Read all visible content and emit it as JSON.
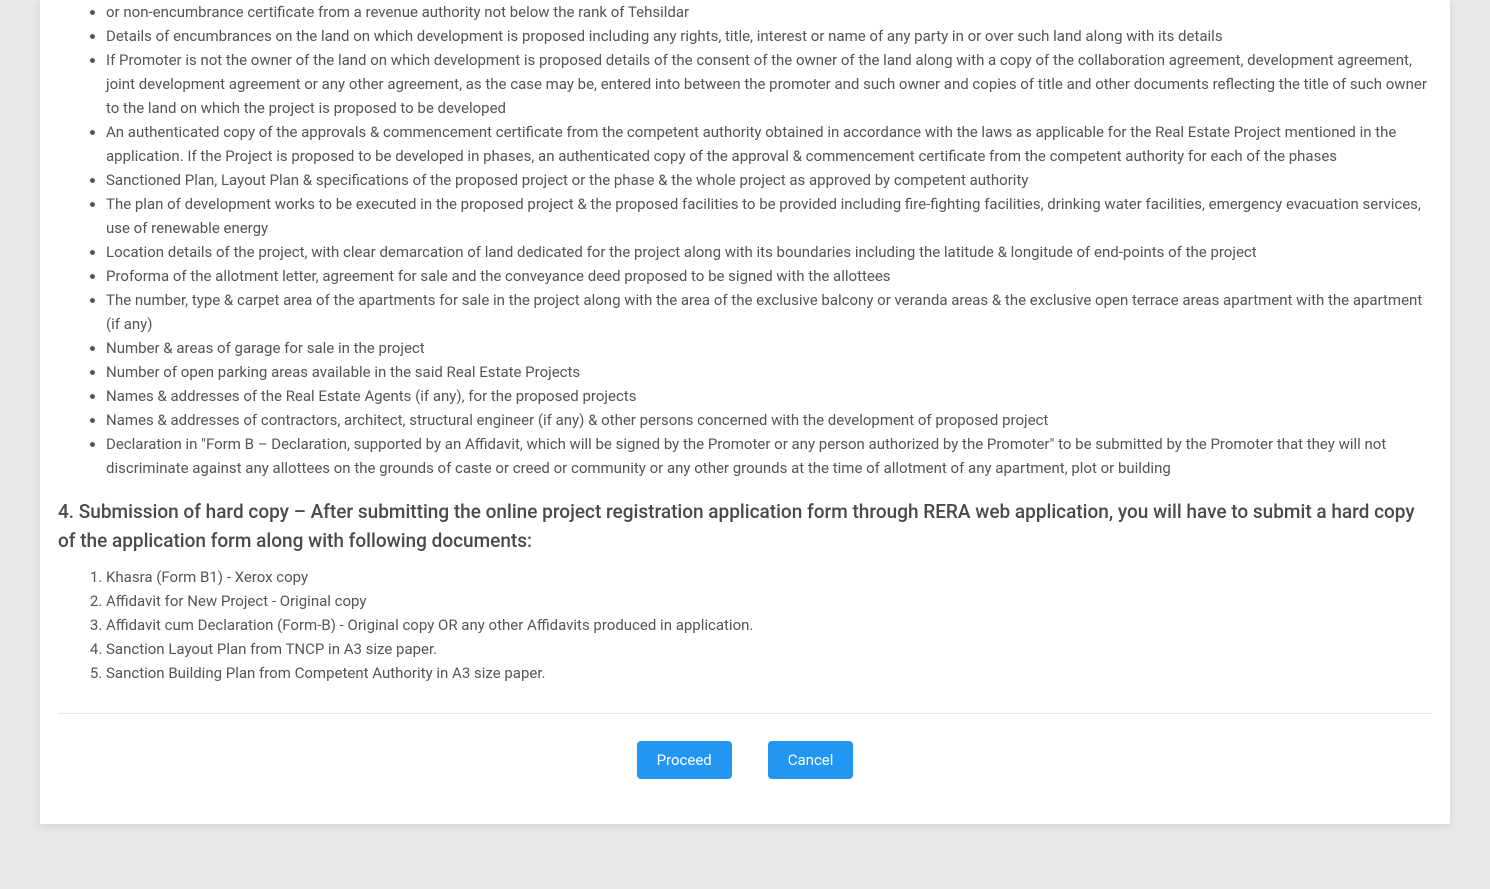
{
  "bulletItems": [
    "or non-encumbrance certificate from a revenue authority not below the rank of Tehsildar",
    "Details of encumbrances on the land on which development is proposed including any rights, title, interest or name of any party in or over such land along with its details",
    "If Promoter is not the owner of the land on which development is proposed details of the consent of the owner of the land along with a copy of the collaboration agreement, development agreement, joint development agreement or any other agreement, as the case may be, entered into between the promoter and such owner and copies of title and other documents reflecting the title of such owner to the land on which the project is proposed to be developed",
    "An authenticated copy of the approvals & commencement certificate from the competent authority obtained in accordance with the laws as applicable for the Real Estate Project mentioned in the application. If the Project is proposed to be developed in phases, an authenticated copy of the approval & commencement certificate from the competent authority for each of the phases",
    "Sanctioned Plan, Layout Plan & specifications of the proposed project or the phase & the whole project as approved by competent authority",
    "The plan of development works to be executed in the proposed project & the proposed facilities to be provided including fire-fighting facilities, drinking water facilities, emergency evacuation services, use of renewable energy",
    "Location details of the project, with clear demarcation of land dedicated for the project along with its boundaries including the latitude & longitude of end-points of the project",
    "Proforma of the allotment letter, agreement for sale and the conveyance deed proposed to be signed with the allottees",
    "The number, type & carpet area of the apartments for sale in the project along with the area of the exclusive balcony or veranda areas & the exclusive open terrace areas apartment with the apartment (if any)",
    "Number & areas of garage for sale in the project",
    "Number of open parking areas available in the said Real Estate Projects",
    "Names & addresses of the Real Estate Agents (if any), for the proposed projects",
    "Names & addresses of contractors, architect, structural engineer (if any) & other persons concerned with the development of proposed project",
    "Declaration in \"Form B – Declaration, supported by an Affidavit, which will be signed by the Promoter or any person authorized by the Promoter\" to be submitted by the Promoter that they will not discriminate against any allottees on the grounds of caste or creed or community or any other grounds at the time of allotment of any apartment, plot or building"
  ],
  "section4Heading": "4. Submission of hard copy – After submitting the online project registration application form through RERA web application, you will have to submit a hard copy of the application form along with following documents:",
  "numberedItems": [
    "Khasra (Form B1) - Xerox copy",
    "Affidavit for New Project - Original copy",
    "Affidavit cum Declaration (Form-B) - Original copy OR any other Affidavits produced in application.",
    "Sanction Layout Plan from TNCP in A3 size paper.",
    "Sanction Building Plan from Competent Authority in A3 size paper."
  ],
  "buttons": {
    "proceed": "Proceed",
    "cancel": "Cancel"
  }
}
